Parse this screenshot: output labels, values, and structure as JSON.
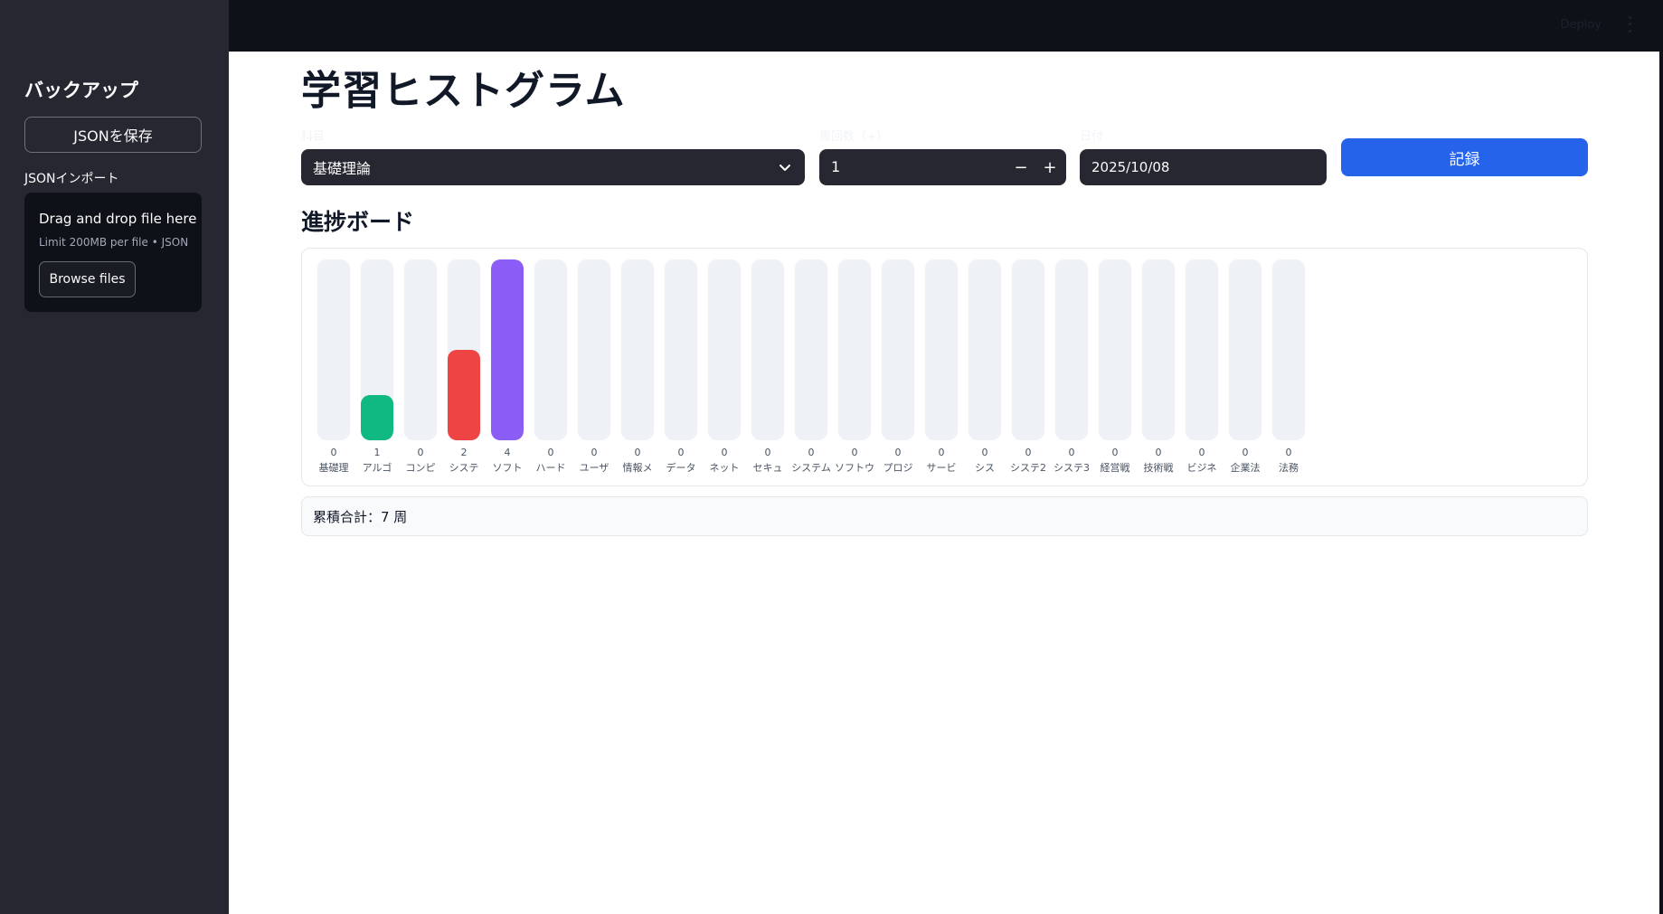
{
  "sidebar": {
    "title": "バックアップ",
    "save_button": "JSONを保存",
    "import_label": "JSONインポート",
    "dropzone": {
      "title": "Drag and drop file here",
      "limit": "Limit 200MB per file • JSON",
      "browse_button": "Browse files"
    }
  },
  "topbar": {
    "deploy_label": "Deploy"
  },
  "main": {
    "title": "学習ヒストグラム",
    "form": {
      "subject_label": "科目",
      "subject_value": "基礎理論",
      "count_label": "周回数（+）",
      "count_value": "1",
      "minus": "−",
      "plus": "+",
      "date_label": "日付",
      "date_value": "2025/10/08",
      "record_button": "記録"
    },
    "board_title": "進捗ボード",
    "total_text": "累積合計：7 周"
  },
  "colors": {
    "accent": "#2563eb",
    "green": "#10b981",
    "red": "#ef4444",
    "purple": "#8b5cf6",
    "track": "#eef1f5"
  },
  "chart_data": {
    "type": "bar",
    "categories": [
      "基礎理",
      "アルゴ",
      "コンピ",
      "システ",
      "ソフト",
      "ハード",
      "ユーザ",
      "情報メ",
      "データ",
      "ネット",
      "セキュ",
      "システム",
      "ソフトウ",
      "プロジ",
      "サービ",
      "シス",
      "システ2",
      "システ3",
      "経営戦",
      "技術戦",
      "ビジネ",
      "企業法",
      "法務"
    ],
    "values": [
      0,
      1,
      0,
      2,
      4,
      0,
      0,
      0,
      0,
      0,
      0,
      0,
      0,
      0,
      0,
      0,
      0,
      0,
      0,
      0,
      0,
      0,
      0
    ],
    "value_labels": [
      "0",
      "1",
      "0",
      "2",
      "4",
      "0",
      "0",
      "0",
      "0",
      "0",
      "0",
      "0",
      "0",
      "0",
      "0",
      "0",
      "0",
      "0",
      "0",
      "0",
      "0",
      "0",
      "0"
    ],
    "bar_colors": [
      "#10b981",
      "#10b981",
      "#10b981",
      "#ef4444",
      "#8b5cf6",
      "#10b981",
      "#10b981",
      "#10b981",
      "#10b981",
      "#10b981",
      "#10b981",
      "#10b981",
      "#10b981",
      "#10b981",
      "#10b981",
      "#10b981",
      "#10b981",
      "#10b981",
      "#10b981",
      "#10b981",
      "#10b981",
      "#10b981",
      "#10b981"
    ],
    "ylim": [
      0,
      4
    ],
    "title": "",
    "xlabel": "",
    "ylabel": ""
  }
}
